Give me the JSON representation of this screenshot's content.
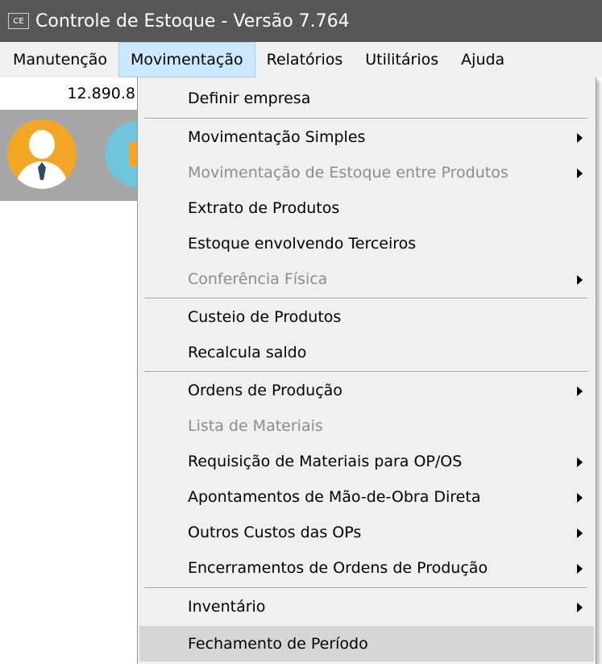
{
  "window": {
    "icon_text": "CE",
    "title": "Controle de Estoque - Versão 7.764"
  },
  "menubar": {
    "items": [
      {
        "label": "Manutenção"
      },
      {
        "label": "Movimentação",
        "active": true
      },
      {
        "label": "Relatórios"
      },
      {
        "label": "Utilitários"
      },
      {
        "label": "Ajuda"
      }
    ]
  },
  "value_field": {
    "text": "12.890.8"
  },
  "toolbar": {
    "buttons": [
      {
        "icon": "user-avatar-icon"
      },
      {
        "icon": "truck-icon"
      }
    ]
  },
  "movimentacao_menu": {
    "items": [
      {
        "label": "Definir empresa",
        "enabled": true,
        "submenu": false
      },
      {
        "label": "Movimentação Simples",
        "enabled": true,
        "submenu": true
      },
      {
        "label": "Movimentação de Estoque entre Produtos",
        "enabled": false,
        "submenu": true
      },
      {
        "label": "Extrato de Produtos",
        "enabled": true,
        "submenu": false
      },
      {
        "label": "Estoque envolvendo Terceiros",
        "enabled": true,
        "submenu": false
      },
      {
        "label": "Conferência Física",
        "enabled": false,
        "submenu": true
      },
      {
        "label": "Custeio de Produtos",
        "enabled": true,
        "submenu": false
      },
      {
        "label": "Recalcula saldo",
        "enabled": true,
        "submenu": false
      },
      {
        "label": "Ordens de Produção",
        "enabled": true,
        "submenu": true
      },
      {
        "label": "Lista de Materiais",
        "enabled": false,
        "submenu": false
      },
      {
        "label": "Requisição de Materiais para OP/OS",
        "enabled": true,
        "submenu": true
      },
      {
        "label": "Apontamentos de Mão-de-Obra Direta",
        "enabled": true,
        "submenu": true
      },
      {
        "label": "Outros Custos das OPs",
        "enabled": true,
        "submenu": true
      },
      {
        "label": "Encerramentos de Ordens de Produção",
        "enabled": true,
        "submenu": true
      },
      {
        "label": "Inventário",
        "enabled": true,
        "submenu": true
      },
      {
        "label": "Fechamento de Período",
        "enabled": true,
        "submenu": false,
        "highlighted": true
      }
    ]
  },
  "colors": {
    "titlebar": "#575757",
    "menu_background": "#f0f0f0",
    "active_menu": "#cce8ff",
    "highlight": "#d6d6d6",
    "disabled_text": "#8c8c8c"
  }
}
